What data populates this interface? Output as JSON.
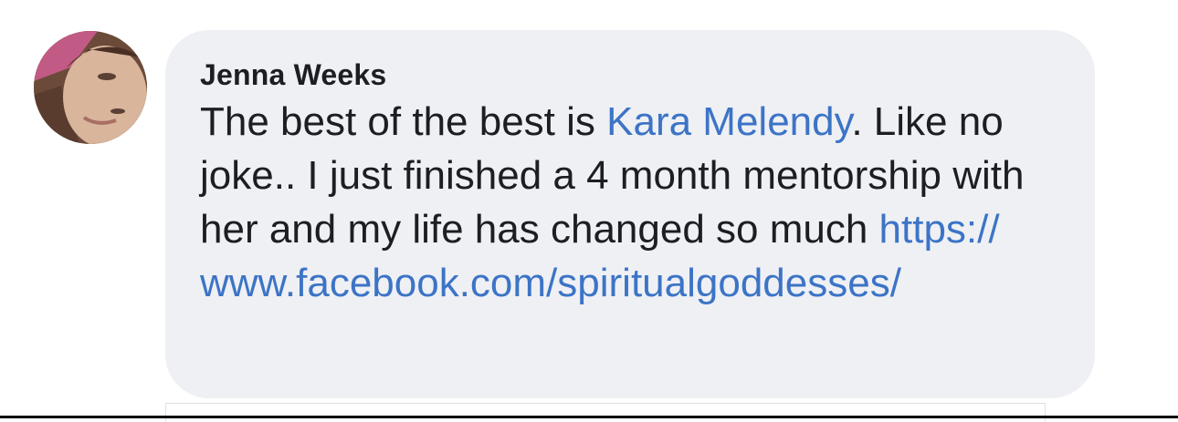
{
  "comment": {
    "author": "Jenna Weeks",
    "text_before_mention": "The best of the best is ",
    "mention": "Kara Melendy",
    "text_after_mention": ". Like no joke.. I just finished a 4 month mentorship with her and my life has changed so much ",
    "link_part_1": "https://",
    "link_part_2": "www.facebook.com/spiritualgoddesses/",
    "avatar_icon": "profile-photo"
  },
  "colors": {
    "bubble_background": "#eff0f4",
    "link": "#3c74c6",
    "text": "#1c1e21"
  }
}
